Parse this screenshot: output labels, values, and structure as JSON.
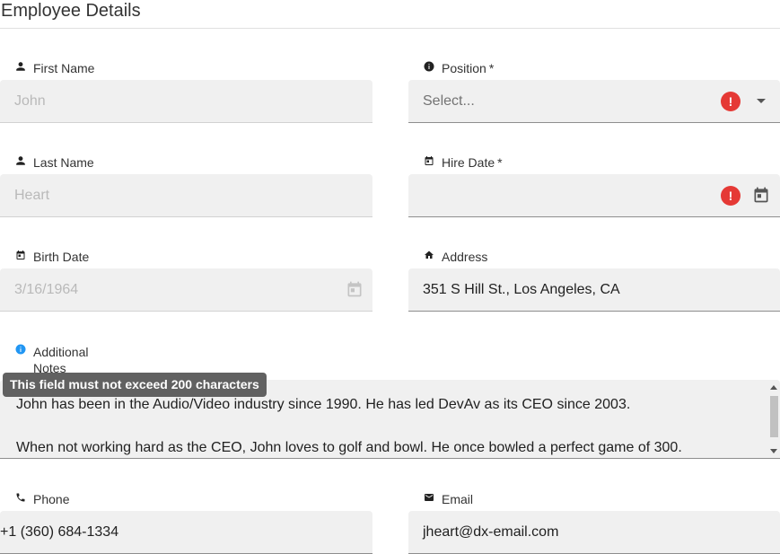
{
  "title": "Employee Details",
  "fields": {
    "first_name": {
      "label": "First Name",
      "value": "John",
      "icon": "person-icon"
    },
    "position": {
      "label": "Position",
      "required_mark": "*",
      "placeholder": "Select...",
      "icon": "info-icon",
      "error_icon_text": "!"
    },
    "last_name": {
      "label": "Last Name",
      "value": "Heart",
      "icon": "person-icon"
    },
    "hire_date": {
      "label": "Hire Date",
      "required_mark": "*",
      "value": "",
      "icon": "calendar-icon",
      "error_icon_text": "!"
    },
    "birth_date": {
      "label": "Birth Date",
      "value": "3/16/1964",
      "icon": "calendar-icon"
    },
    "address": {
      "label": "Address",
      "value": "351 S Hill St., Los Angeles, CA",
      "icon": "home-icon"
    },
    "notes": {
      "label_line1": "Additional",
      "label_line2": "Notes",
      "tooltip": "This field must not exceed 200 characters",
      "line1": "John has been in the Audio/Video industry since 1990. He has led DevAv as its CEO since 2003.",
      "line2": "When not working hard as the CEO, John loves to golf and bowl. He once bowled a perfect game of 300.",
      "icon": "info-blue-icon"
    },
    "phone": {
      "label": "Phone",
      "value": "+1 (360) 684-1334",
      "icon": "phone-icon"
    },
    "email": {
      "label": "Email",
      "value": "jheart@dx-email.com",
      "icon": "email-icon"
    }
  },
  "colors": {
    "error": "#e53935",
    "info": "#2196f3",
    "field_bg": "#f0f0f0",
    "tooltip_bg": "#616161"
  }
}
